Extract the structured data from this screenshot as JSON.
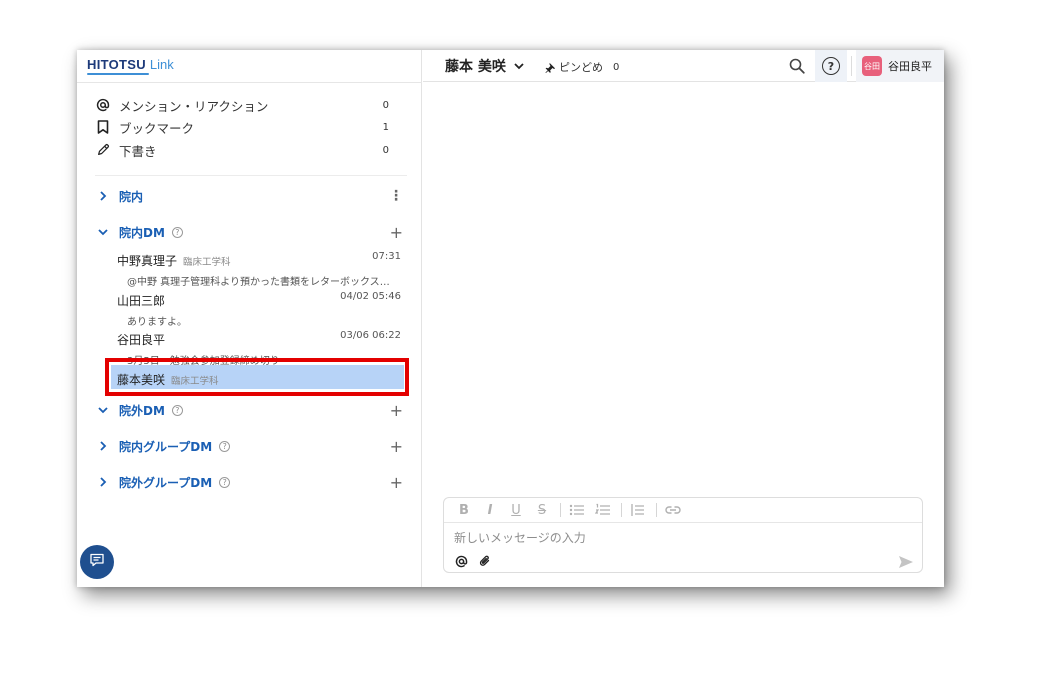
{
  "logo": {
    "main": "HITOTSU",
    "sub": "Link"
  },
  "quick": [
    {
      "label": "メンション・リアクション",
      "count": "0",
      "icon": "at-icon"
    },
    {
      "label": "ブックマーク",
      "count": "1",
      "icon": "bookmark-icon"
    },
    {
      "label": "下書き",
      "count": "0",
      "icon": "pencil-icon"
    }
  ],
  "sections": {
    "innai": {
      "label": "院内",
      "action": "⋮"
    },
    "innai_dm": {
      "label": "院内DM",
      "help": "?",
      "action": "+"
    },
    "ingai_dm": {
      "label": "院外DM",
      "help": "?",
      "action": "+"
    },
    "innai_group": {
      "label": "院内グループDM",
      "help": "?",
      "action": "+"
    },
    "ingai_group": {
      "label": "院外グループDM",
      "help": "?",
      "action": "+"
    }
  },
  "dms": [
    {
      "name": "中野真理子",
      "dept": "臨床工学科",
      "time": "07:31",
      "preview": "@中野 真理子管理科より預かった書類をレターボックスに入れておきました。"
    },
    {
      "name": "山田三郎",
      "dept": "",
      "time": "04/02 05:46",
      "preview": "ありますよ。"
    },
    {
      "name": "谷田良平",
      "dept": "",
      "time": "03/06 06:22",
      "preview": "3月5日　勉強会参加登録締め切り"
    },
    {
      "name": "藤本美咲",
      "dept": "臨床工学科",
      "time": "",
      "preview": ""
    }
  ],
  "header": {
    "title": "藤本 美咲",
    "pin_label": "ピンどめ",
    "pin_count": "0",
    "help": "?",
    "avatar_text": "谷田",
    "username": "谷田良平"
  },
  "composer": {
    "placeholder": "新しいメッセージの入力",
    "value": "",
    "toolbar": {
      "bold": "B",
      "italic": "I",
      "underline": "U",
      "strike": "S"
    }
  },
  "colors": {
    "accent": "#1a5fb4",
    "selected": "#b7d3f7",
    "highlight": "#e30000",
    "avatar": "#e8607b",
    "fab": "#1f4f8f"
  }
}
